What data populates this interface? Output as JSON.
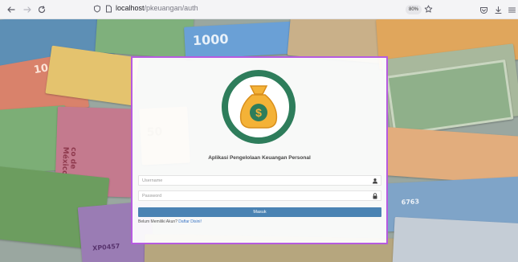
{
  "browser": {
    "url_host": "localhost",
    "url_path": "/pkeuangan/auth",
    "zoom": "80%"
  },
  "login": {
    "app_title": "Aplikasi Pengelolaan Keuangan Personal",
    "username_placeholder": "Username",
    "password_placeholder": "Password",
    "submit_label": "Masuk",
    "no_account_text": "Belum Memiliki Akun?",
    "register_link": "Daftar Disini!"
  },
  "background": {
    "banknote_texts": [
      "1000",
      "10",
      "50",
      "co de México",
      "XP0457",
      "6763"
    ]
  },
  "icons": {
    "back": "arrow-left-icon",
    "forward": "arrow-right-icon",
    "reload": "reload-icon",
    "shield": "shield-icon",
    "page": "page-icon",
    "bookmark": "star-icon",
    "pocket": "pocket-icon",
    "download": "download-icon",
    "menu": "hamburger-menu-icon",
    "user": "user-icon",
    "lock": "lock-icon",
    "money_bag": "money-bag-icon"
  },
  "colors": {
    "card_border": "#b65be0",
    "button": "#4a83b3",
    "logo_ring": "#2e7d5b",
    "bag": "#f4b237",
    "link": "#3a75c4"
  }
}
